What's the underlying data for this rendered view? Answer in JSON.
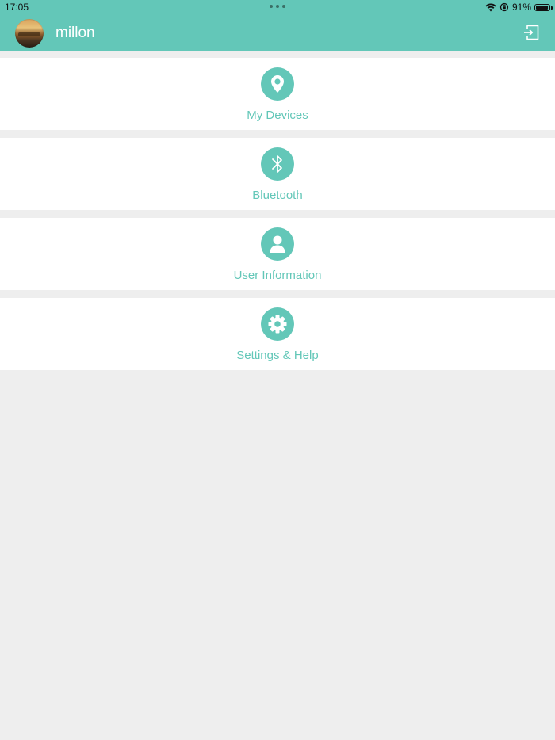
{
  "status_bar": {
    "time": "17:05",
    "battery": "91%",
    "battery_level": 0.91
  },
  "header": {
    "username": "millon",
    "logout_icon": "logout-icon"
  },
  "menu": {
    "items": [
      {
        "label": "My Devices",
        "icon": "location-pin-icon"
      },
      {
        "label": "Bluetooth",
        "icon": "bluetooth-icon"
      },
      {
        "label": "User Information",
        "icon": "user-icon"
      },
      {
        "label": "Settings & Help",
        "icon": "gear-icon"
      }
    ]
  },
  "colors": {
    "accent": "#63c7b8",
    "background": "#eeeeee",
    "card": "#ffffff"
  }
}
